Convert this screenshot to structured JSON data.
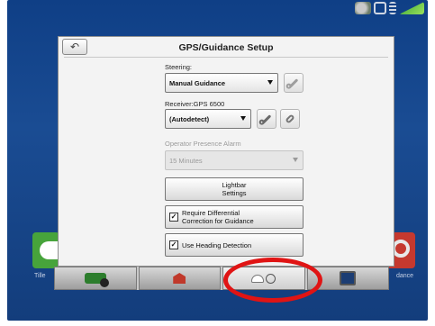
{
  "dialog": {
    "title": "GPS/Guidance Setup",
    "back_glyph": "↶",
    "steering_label": "Steering:",
    "steering_value": "Manual Guidance",
    "receiver_label": "Receiver:GPS 6500",
    "receiver_value": "(Autodetect)",
    "operator_label": "Operator Presence Alarm",
    "operator_value": "15 Minutes",
    "lightbar_line1": "Lightbar",
    "lightbar_line2": "Settings",
    "diff_line1": "Require Differential",
    "diff_line2": "Correction for Guidance",
    "diff_checked": "✓",
    "heading_label": "Use Heading Detection",
    "heading_checked": "✓"
  },
  "side": {
    "left_label": "Tille",
    "right_label": "dance"
  },
  "bottom_nav": {
    "items": [
      "tractor-icon",
      "barn-icon",
      "gps-receiver-icon",
      "display-icon"
    ],
    "active_index": 2
  },
  "colors": {
    "background": "#1a4c93",
    "highlight": "#e01414",
    "left_tile": "#47a43b",
    "right_tile": "#c5392f"
  }
}
